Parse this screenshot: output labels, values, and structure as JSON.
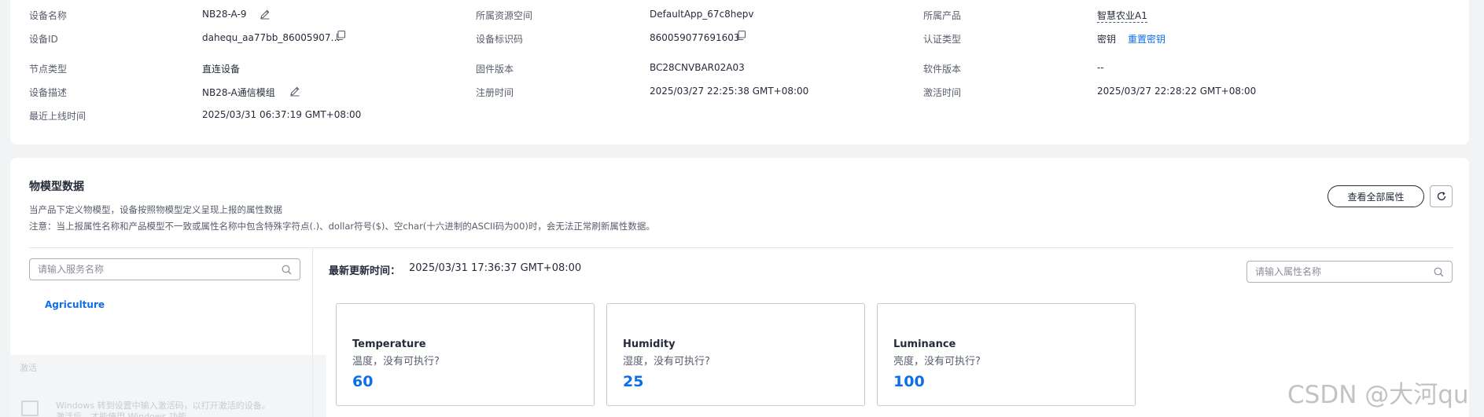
{
  "device_info": {
    "device_name_label": "设备名称",
    "device_name_value": "NB28-A-9",
    "device_id_label": "设备ID",
    "device_id_value": "dahequ_aa77bb_86005907…",
    "node_type_label": "节点类型",
    "node_type_value": "直连设备",
    "device_desc_label": "设备描述",
    "device_desc_value": "NB28-A通信模组",
    "last_online_label": "最近上线时间",
    "last_online_value": "2025/03/31 06:37:19 GMT+08:00",
    "resource_space_label": "所属资源空间",
    "resource_space_value": "DefaultApp_67c8hepv",
    "device_identifier_label": "设备标识码",
    "device_identifier_value": "860059077691603",
    "firmware_label": "固件版本",
    "firmware_value": "BC28CNVBAR02A03",
    "register_time_label": "注册时间",
    "register_time_value": "2025/03/27 22:25:38 GMT+08:00",
    "product_label": "所属产品",
    "product_value": "智慧农业A1",
    "auth_type_label": "认证类型",
    "auth_type_value": "密钥",
    "reset_key_link": "重置密钥",
    "software_label": "软件版本",
    "software_value": "--",
    "activate_time_label": "激活时间",
    "activate_time_value": "2025/03/27 22:28:22 GMT+08:00"
  },
  "model_section": {
    "title": "物模型数据",
    "desc_line1": "当产品下定义物模型，设备按照物模型定义呈现上报的属性数据",
    "desc_line2": "注意：当上报属性名称和产品模型不一致或属性名称中包含特殊字符点(.)、dollar符号($)、空char(十六进制的ASCII码为00)时，会无法正常刷新属性数据。",
    "view_all_button": "查看全部属性",
    "service_search_placeholder": "请输入服务名称",
    "property_search_placeholder": "请输入属性名称",
    "service_items": [
      "Agriculture"
    ],
    "last_update_label": "最新更新时间：",
    "last_update_value": "2025/03/31 17:36:37 GMT+08:00",
    "properties": [
      {
        "name": "Temperature",
        "desc": "温度，没有可执行?",
        "value": "60"
      },
      {
        "name": "Humidity",
        "desc": "湿度，没有可执行?",
        "value": "25"
      },
      {
        "name": "Luminance",
        "desc": "亮度，没有可执行?",
        "value": "100"
      }
    ]
  },
  "overlay": {
    "line1": "激活",
    "line2": "Windows 转到设置中输入激活码，以打开激活的设备。",
    "line3": "激活后，才能使用 Windows 功能。"
  },
  "watermark": "CSDN @大河qu",
  "colors": {
    "accent": "#0e6ee8",
    "text": "#252b3a",
    "muted": "#575d6c",
    "border": "#c8cad0"
  },
  "icons": [
    "edit-icon",
    "copy-icon",
    "search-icon",
    "refresh-icon"
  ]
}
